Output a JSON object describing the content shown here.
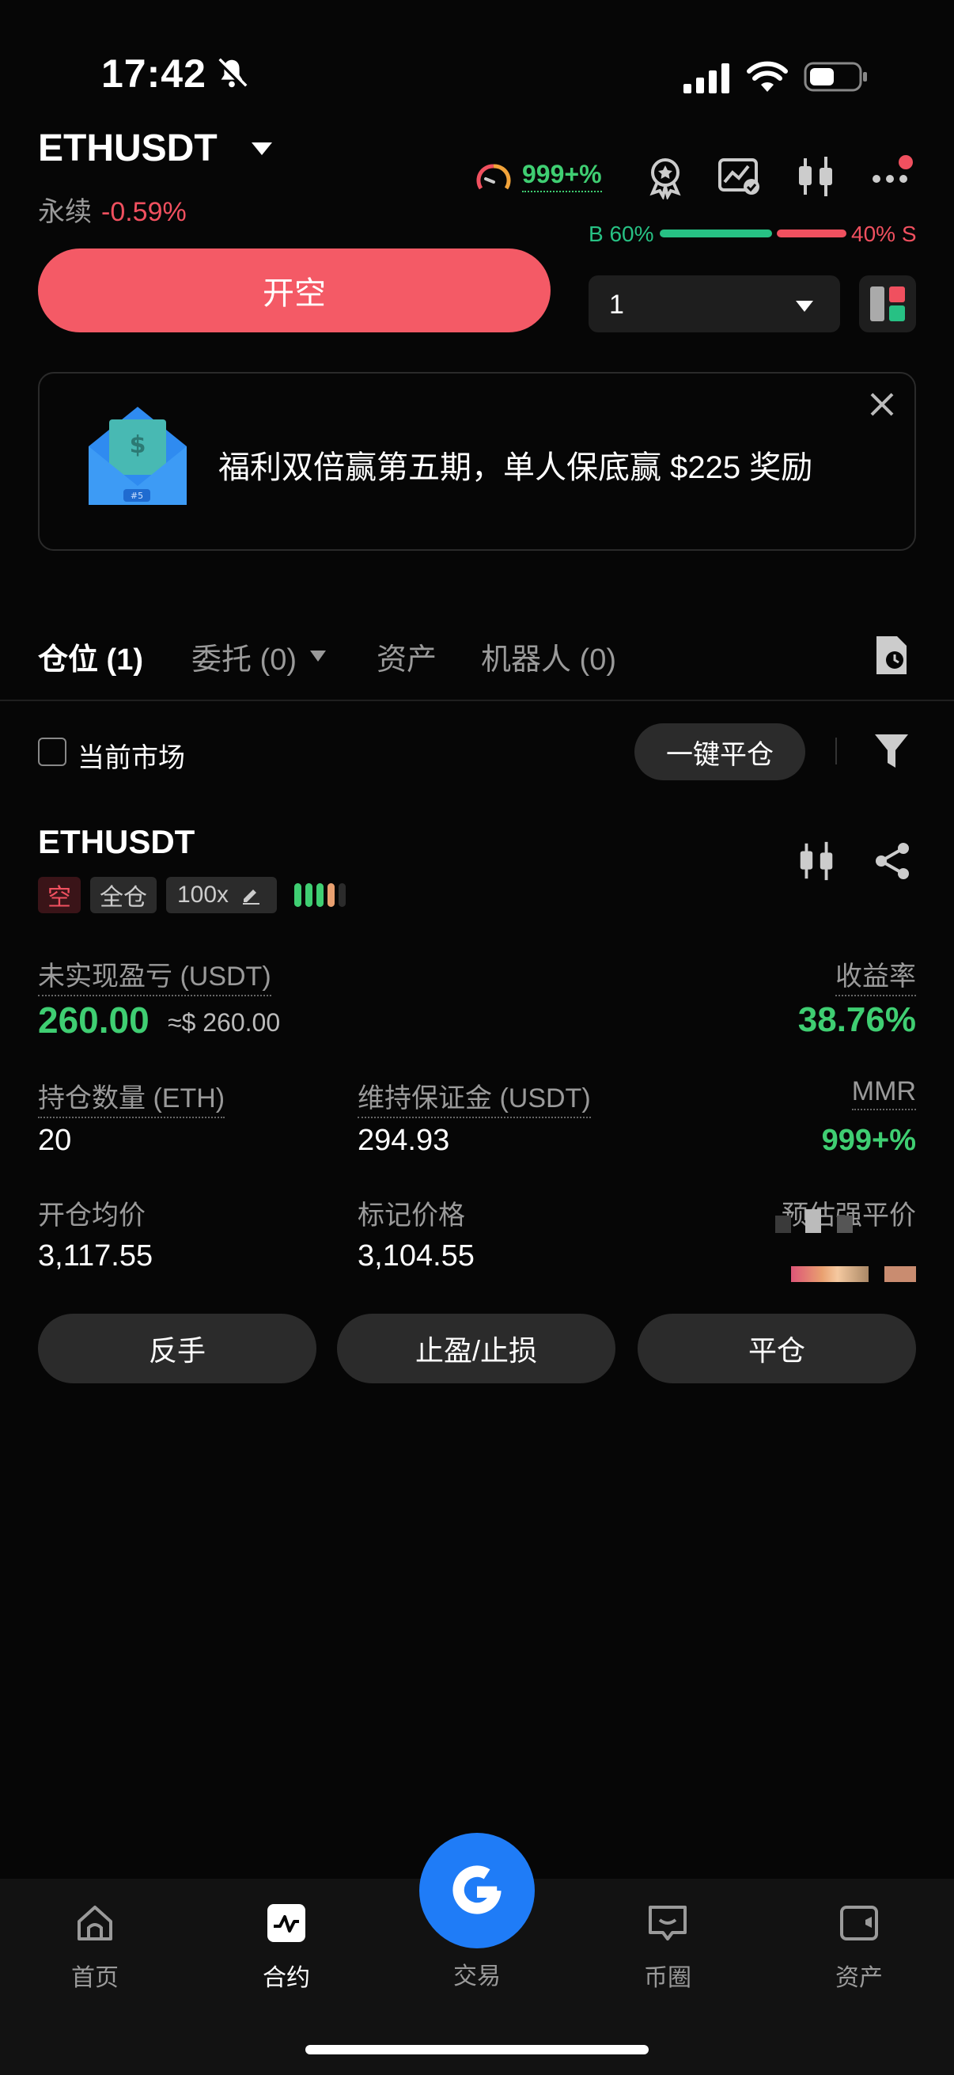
{
  "status_bar": {
    "time": "17:42"
  },
  "header": {
    "pair": "ETHUSDT",
    "contract_type": "永续",
    "change": "-0.59%",
    "mmr_indicator": "999+%",
    "buy_label": "B 60%",
    "sell_label": "40% S",
    "buy_ratio": 0.6,
    "sell_ratio": 0.4
  },
  "order": {
    "open_short_label": "开空",
    "quantity_value": "1"
  },
  "banner": {
    "text": "福利双倍赢第五期，单人保底赢 $225 奖励",
    "envelope_badge": "#5"
  },
  "tabs": [
    {
      "label": "仓位 (1)"
    },
    {
      "label": "委托 (0)"
    },
    {
      "label": "资产"
    },
    {
      "label": "机器人 (0)"
    }
  ],
  "filter_row": {
    "current_market_label": "当前市场",
    "close_all_label": "一键平仓"
  },
  "position": {
    "symbol": "ETHUSDT",
    "side_tag": "空",
    "margin_mode_tag": "全仓",
    "leverage_tag": "100x",
    "unrealized_pnl_label": "未实现盈亏 (USDT)",
    "unrealized_pnl_value": "260.00",
    "unrealized_pnl_approx": "≈$ 260.00",
    "roe_label": "收益率",
    "roe_value": "38.76%",
    "size_label": "持仓数量 (ETH)",
    "size_value": "20",
    "maint_margin_label": "维持保证金 (USDT)",
    "maint_margin_value": "294.93",
    "mmr_label": "MMR",
    "mmr_value": "999+%",
    "entry_price_label": "开仓均价",
    "entry_price_value": "3,117.55",
    "mark_price_label": "标记价格",
    "mark_price_value": "3,104.55",
    "liq_price_label": "预估强平价"
  },
  "actions": {
    "reverse_label": "反手",
    "tpsl_label": "止盈/止损",
    "close_label": "平仓"
  },
  "bottom_nav": [
    {
      "label": "首页"
    },
    {
      "label": "合约"
    },
    {
      "label": "交易"
    },
    {
      "label": "币圈"
    },
    {
      "label": "资产"
    }
  ],
  "colors": {
    "accent_red": "#f45a66",
    "accent_green": "#3fce72",
    "brand_blue": "#1f7cf7",
    "background": "#060606"
  }
}
